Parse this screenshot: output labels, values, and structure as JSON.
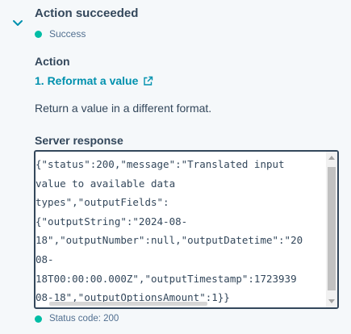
{
  "header": {
    "title": "Action succeeded",
    "status_label": "Success",
    "status_color": "#00bda5",
    "expand_icon": "chevron-down-icon"
  },
  "action": {
    "section_label": "Action",
    "name": "1. Reformat a value",
    "link_icon": "external-link-icon",
    "link_color": "#0091ae",
    "description": "Return a value in a different format."
  },
  "response": {
    "section_label": "Server response",
    "lines": [
      "{\"status\":200,\"message\":\"Translated input",
      "value to available data",
      "types\",\"outputFields\":",
      "{\"outputString\":\"2024-08-",
      "18\",\"outputNumber\":null,\"outputDatetime\":\"20",
      "08-",
      "18T00:00:00.000Z\",\"outputTimestamp\":1723939",
      "08-18\",\"outputOptionsAmount\":1}}"
    ],
    "status_code_label": "Status code: 200"
  }
}
